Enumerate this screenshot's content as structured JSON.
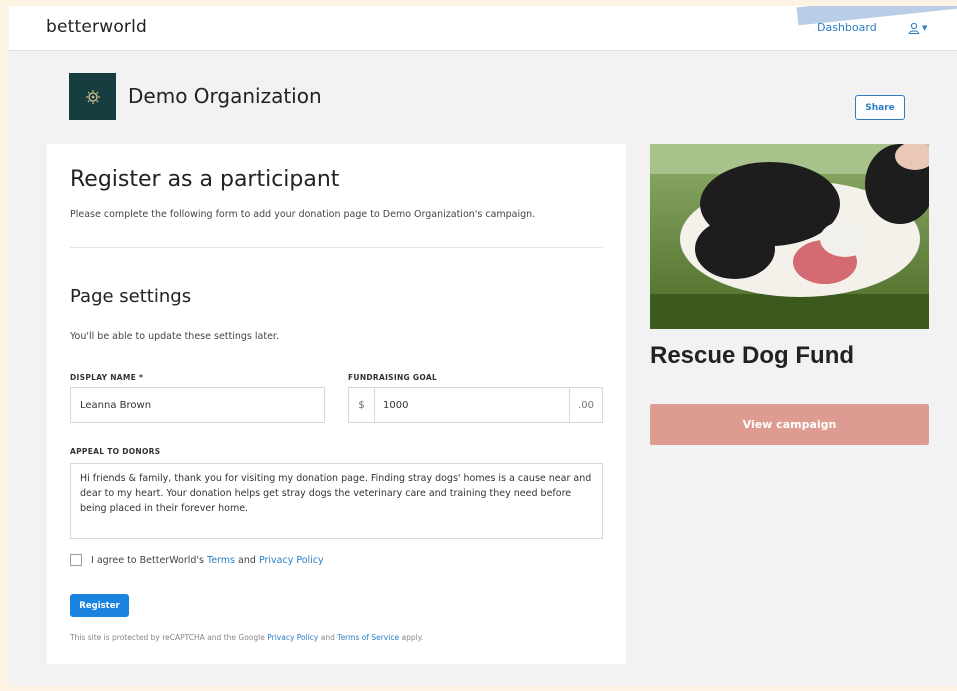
{
  "nav": {
    "logo": "betterworld",
    "dashboard_label": "Dashboard",
    "user_icon": "user-icon",
    "chevron_icon": "chevron-down-icon"
  },
  "org": {
    "name": "Demo Organization",
    "logo_icon": "emblem-icon",
    "share_label": "Share"
  },
  "form": {
    "title": "Register as a participant",
    "intro": "Please complete the following form to add your donation page to Demo Organization's campaign.",
    "section_title": "Page settings",
    "section_sub": "You'll be able to update these settings later.",
    "display_name_label": "DISPLAY NAME *",
    "display_name_value": "Leanna Brown",
    "goal_label": "FUNDRAISING GOAL",
    "goal_prefix": "$",
    "goal_value": "1000",
    "goal_suffix": ".00",
    "appeal_label": "APPEAL TO DONORS",
    "appeal_value": "Hi friends & family, thank you for visiting my donation page. Finding stray dogs' homes is a cause near and dear to my heart. Your donation helps get stray dogs the veterinary care and training they need before being placed in their forever home.",
    "agree_prefix": "I agree to BetterWorld's",
    "agree_terms": "Terms",
    "agree_and": "and",
    "agree_privacy": "Privacy Policy",
    "register_label": "Register",
    "recaptcha_prefix": "This site is protected by reCAPTCHA and the Google",
    "recaptcha_privacy": "Privacy Policy",
    "recaptcha_and": "and",
    "recaptcha_terms": "Terms of Service",
    "recaptcha_suffix": "apply."
  },
  "campaign": {
    "title": "Rescue Dog Fund",
    "view_label": "View campaign"
  },
  "colors": {
    "accent": "#2a7dc4",
    "register": "#1a83e0",
    "view_button": "#de9b92",
    "org_logo_bg": "#163d3f"
  }
}
